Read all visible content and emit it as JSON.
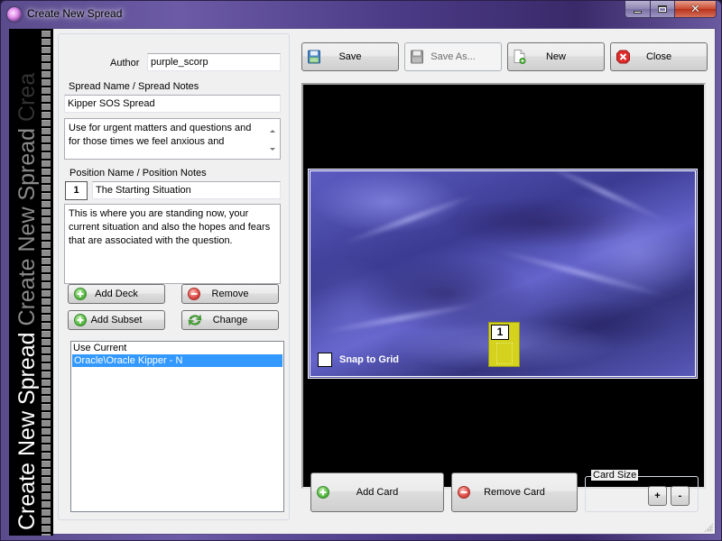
{
  "window": {
    "title": "Create New Spread",
    "controls": {
      "minimize": "minimize",
      "maximize": "maximize",
      "close": "close"
    }
  },
  "sidebar": {
    "banner_text": "Create New Spread",
    "banner_repeat_dim": "Create New Spread",
    "banner_repeat_dark": "Crea"
  },
  "form": {
    "author_label": "Author",
    "author_value": "purple_scorp",
    "spread_section_label": "Spread Name / Spread Notes",
    "spread_name_value": "Kipper SOS Spread",
    "spread_notes_value": "Use for urgent matters and questions and for those times we feel anxious and",
    "position_section_label": "Position Name / Position Notes",
    "position_number": "1",
    "position_name_value": "The Starting Situation",
    "position_notes_value": "This is where you are standing now, your current situation and also the hopes and fears that are associated with the question."
  },
  "deck_buttons": {
    "add_deck": "Add Deck",
    "remove": "Remove",
    "add_subset": "Add Subset",
    "change": "Change"
  },
  "deck_list": {
    "items": [
      {
        "label": "Use Current",
        "selected": false
      },
      {
        "label": "Oracle\\Oracle Kipper - N",
        "selected": true
      }
    ]
  },
  "toolbar": {
    "save": "Save",
    "save_as": "Save As...",
    "new": "New",
    "close": "Close"
  },
  "canvas": {
    "snap_to_grid_label": "Snap to Grid",
    "snap_to_grid_checked": false,
    "cards": [
      {
        "number": "1",
        "color": "#d4d21c"
      }
    ]
  },
  "bottom": {
    "add_card": "Add Card",
    "remove_card": "Remove Card",
    "card_size_label": "Card Size",
    "increase": "+",
    "decrease": "-"
  },
  "colors": {
    "selection": "#3399ff",
    "board": "#4a4aa6",
    "card": "#d4d21c"
  }
}
